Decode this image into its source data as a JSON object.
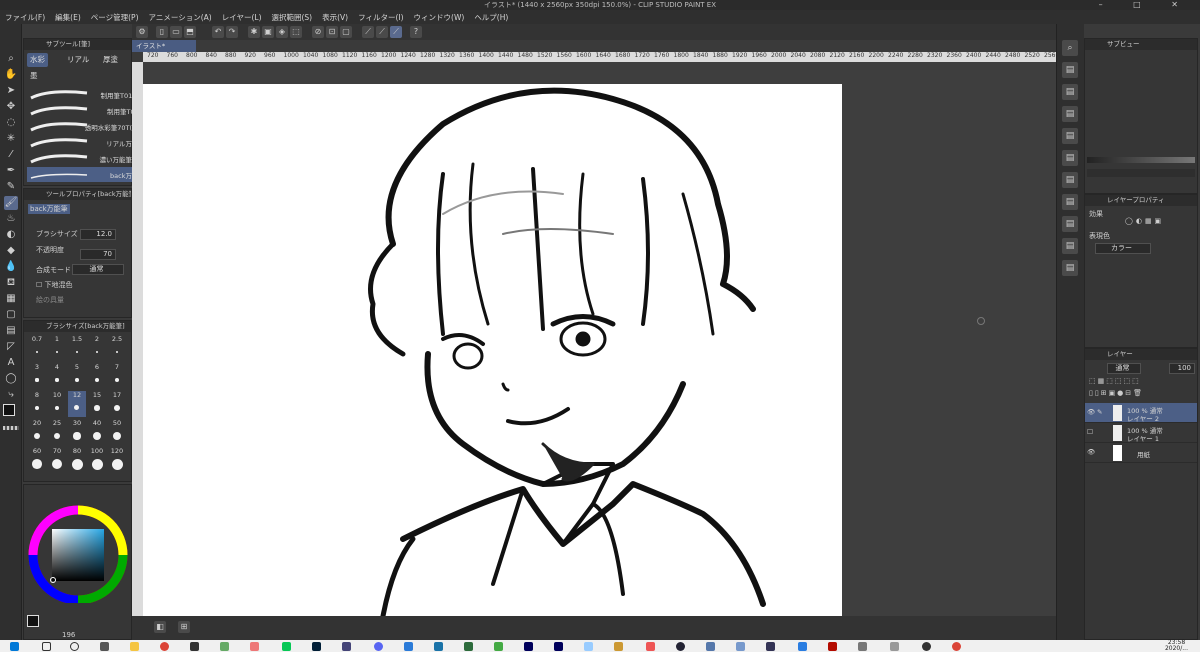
{
  "window": {
    "title": "イラスト* (1440 x 2560px 350dpi 150.0%) - CLIP STUDIO PAINT EX",
    "controls": "–  □  ✕"
  },
  "menu": [
    "ファイル(F)",
    "編集(E)",
    "ページ管理(P)",
    "アニメーション(A)",
    "レイヤー(L)",
    "選択範囲(S)",
    "表示(V)",
    "フィルター(I)",
    "ウィンドウ(W)",
    "ヘルプ(H)"
  ],
  "document_tab": "イラスト*",
  "subtool_panel": {
    "header": "サブツール[筆]",
    "tabs": [
      "水彩",
      "リアル",
      "厚塗"
    ],
    "tab2": "墨",
    "brushes": [
      "制用筆T01 2濃",
      "制用筆T01 2",
      "透明水彩筆70T(水彩",
      "リアル万能筆",
      "濃い万能筆・混",
      "back万能筆"
    ],
    "selected_brush": "back万能筆"
  },
  "tool_property": {
    "header": "ツールプロパティ[back万能筆]",
    "brush_name": "back万能筆",
    "brush_size_label": "ブラシサイズ",
    "brush_size_value": "12.0",
    "opacity_label": "不透明度",
    "opacity_value": "70",
    "blend_label": "合成モード",
    "blend_value": "通常",
    "underlay_label": "下地混色",
    "paint_amount_label": "絵の具量"
  },
  "brush_size_panel": {
    "header": "ブラシサイズ[back万能筆]",
    "sizes": [
      "0.7",
      "1",
      "1.5",
      "2",
      "2.5",
      "3",
      "4",
      "5",
      "6",
      "7",
      "8",
      "10",
      "12",
      "15",
      "17",
      "20",
      "25",
      "30",
      "40",
      "50",
      "60",
      "70",
      "80",
      "100",
      "120"
    ],
    "selected": "12"
  },
  "color": {
    "main": "#111111",
    "sub": "#f2c230",
    "hue": "#27a7e6",
    "bottom_value": "196"
  },
  "ruler_ticks": [
    "720",
    "760",
    "800",
    "840",
    "880",
    "920",
    "960",
    "1000",
    "1040",
    "1080",
    "1120",
    "1160",
    "1200",
    "1240",
    "1280",
    "1320",
    "1360",
    "1400",
    "1440",
    "1480",
    "1520",
    "1560",
    "1600",
    "1640",
    "1680",
    "1720",
    "1760",
    "1800",
    "1840",
    "1880",
    "1920",
    "1960",
    "2000",
    "2040",
    "2080",
    "2120",
    "2160",
    "2200",
    "2240",
    "2280",
    "2320",
    "2360",
    "2400",
    "2440",
    "2480",
    "2520",
    "2560",
    "2600"
  ],
  "sub_view": {
    "header": "サブビュー"
  },
  "layer_property": {
    "header": "レイヤープロパティ",
    "effect_label": "効果",
    "display_color_label": "表現色",
    "display_color_value": "カラー"
  },
  "layer_panel": {
    "header": "レイヤー",
    "blend": "通常",
    "opacity": "100",
    "layers": [
      {
        "percent": "100 % 通常",
        "name": "レイヤー 2",
        "selected": true
      },
      {
        "percent": "100 % 通常",
        "name": "レイヤー 1",
        "selected": false
      },
      {
        "percent": "",
        "name": "用紙",
        "selected": false
      }
    ]
  },
  "taskbar": {
    "time": "23:58",
    "date": "2020/..."
  }
}
